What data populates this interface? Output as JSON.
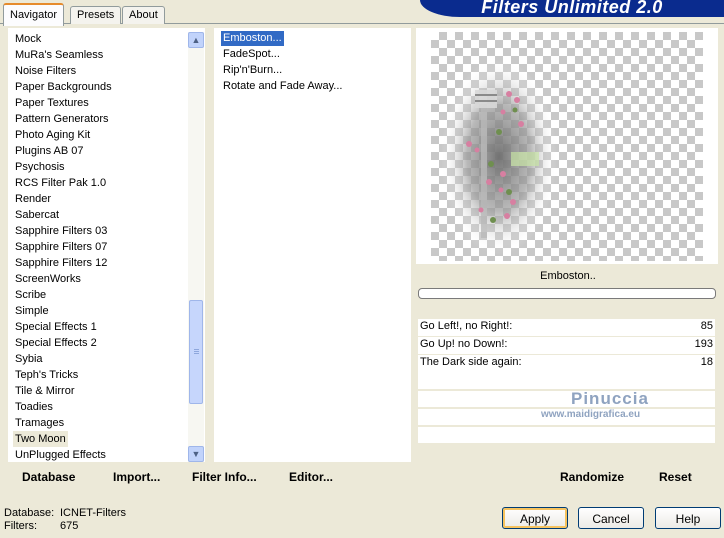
{
  "tabs": [
    {
      "label": "Navigator",
      "active": true
    },
    {
      "label": "Presets",
      "active": false
    },
    {
      "label": "About",
      "active": false
    }
  ],
  "app_title": "Filters Unlimited 2.0",
  "categories": [
    "Mock",
    "MuRa's Seamless",
    "Noise Filters",
    "Paper Backgrounds",
    "Paper Textures",
    "Pattern Generators",
    "Photo Aging Kit",
    "Plugins AB 07",
    "Psychosis",
    "RCS Filter Pak 1.0",
    "Render",
    "Sabercat",
    "Sapphire Filters 03",
    "Sapphire Filters 07",
    "Sapphire Filters 12",
    "ScreenWorks",
    "Scribe",
    "Simple",
    "Special Effects 1",
    "Special Effects 2",
    "Sybia",
    "Teph's Tricks",
    "Tile & Mirror",
    "Toadies",
    "Tramages",
    "Two Moon",
    "UnPlugged Effects"
  ],
  "selected_category": "Two Moon",
  "filters": [
    "Emboston...",
    "FadeSpot...",
    "Rip'n'Burn...",
    "Rotate and Fade Away..."
  ],
  "selected_filter": "Emboston...",
  "left_buttons": {
    "database": "Database",
    "import": "Import...",
    "filter_info": "Filter Info...",
    "editor": "Editor..."
  },
  "preview": {
    "filter_name": "Emboston..",
    "watermark_name": "Pinuccia",
    "watermark_url": "www.maidigrafica.eu"
  },
  "params": [
    {
      "label": "Go Left!, no Right!:",
      "value": "85"
    },
    {
      "label": "Go Up! no Down!:",
      "value": "193"
    },
    {
      "label": "The Dark side again:",
      "value": "18"
    }
  ],
  "right_buttons": {
    "randomize": "Randomize",
    "reset": "Reset"
  },
  "status": {
    "database_label": "Database:",
    "database_value": "ICNET-Filters",
    "filters_label": "Filters:",
    "filters_value": "675"
  },
  "dialog_buttons": {
    "apply": "Apply",
    "cancel": "Cancel",
    "help": "Help"
  },
  "colors": {
    "banner": "#0a2b8e",
    "selection": "#316ac5",
    "face": "#ece9d8"
  }
}
